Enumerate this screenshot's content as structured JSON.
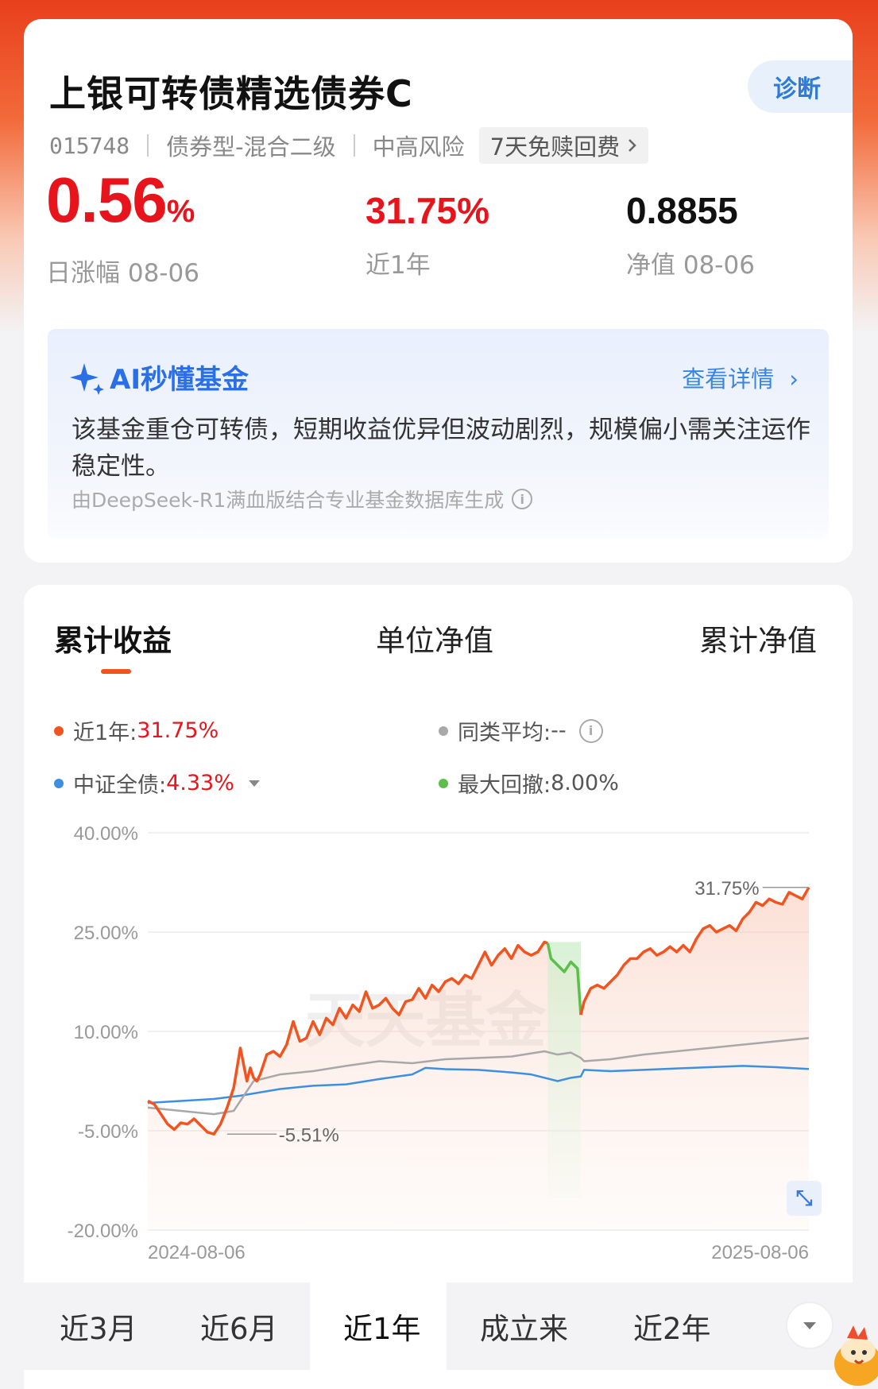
{
  "header": {
    "fund_name": "上银可转债精选债券C",
    "diagnose_label": "诊断",
    "code": "015748",
    "category": "债券型-混合二级",
    "risk": "中高风险",
    "redeem_tag": "7天免赎回费"
  },
  "stats": {
    "daily_change_value": "0.56",
    "daily_change_unit": "%",
    "daily_change_label": "日涨幅 08-06",
    "one_year_value": "31.75%",
    "one_year_label": "近1年",
    "nav_value": "0.8855",
    "nav_label": "净值 08-06"
  },
  "ai": {
    "title": "AI秒懂基金",
    "more": "查看详情",
    "summary": "该基金重仓可转债，短期收益优异但波动剧烈，规模偏小需关注运作稳定性。",
    "footnote": "由DeepSeek-R1满血版结合专业基金数据库生成"
  },
  "chart_tabs": [
    "累计收益",
    "单位净值",
    "累计净值"
  ],
  "legend": {
    "fund_label": "近1年:",
    "fund_value": "31.75%",
    "peer_label": "同类平均:",
    "peer_value": "--",
    "index_label": "中证全债:",
    "index_value": "4.33%",
    "drawdown_label": "最大回撤:",
    "drawdown_value": "8.00%"
  },
  "colors": {
    "fund": "#f2541f",
    "peer": "#a8a8a8",
    "index": "#3d8fe0",
    "drawdown": "#5bbf4a",
    "brand_red": "#e8141c"
  },
  "periods": [
    "近3月",
    "近6月",
    "近1年",
    "成立来",
    "近2年"
  ],
  "active_period": "近1年",
  "watermark": "天天基金",
  "chart_data": {
    "type": "line",
    "ylim": [
      -20,
      40
    ],
    "y_ticks": [
      "40.00%",
      "25.00%",
      "10.00%",
      "-5.00%",
      "-20.00%"
    ],
    "y_tick_values": [
      40,
      25,
      10,
      -5,
      -20
    ],
    "x_start_label": "2024-08-06",
    "x_end_label": "2025-08-06",
    "annotations": [
      {
        "text": "31.75%",
        "x": 1.0,
        "y": 31.75
      },
      {
        "text": "-5.51%",
        "x": 0.12,
        "y": -5.51
      }
    ],
    "drawdown_range": [
      0.605,
      0.655
    ],
    "series": [
      {
        "name": "近1年",
        "x": [
          0,
          0.01,
          0.02,
          0.03,
          0.04,
          0.05,
          0.06,
          0.07,
          0.08,
          0.09,
          0.1,
          0.11,
          0.12,
          0.13,
          0.14,
          0.15,
          0.155,
          0.16,
          0.165,
          0.17,
          0.18,
          0.19,
          0.2,
          0.21,
          0.22,
          0.23,
          0.24,
          0.25,
          0.26,
          0.27,
          0.28,
          0.29,
          0.3,
          0.31,
          0.32,
          0.33,
          0.34,
          0.35,
          0.36,
          0.37,
          0.38,
          0.39,
          0.4,
          0.41,
          0.42,
          0.43,
          0.44,
          0.45,
          0.46,
          0.47,
          0.48,
          0.49,
          0.5,
          0.51,
          0.52,
          0.53,
          0.54,
          0.55,
          0.56,
          0.57,
          0.58,
          0.59,
          0.6,
          0.605,
          0.61,
          0.62,
          0.63,
          0.64,
          0.65,
          0.655,
          0.66,
          0.67,
          0.68,
          0.69,
          0.7,
          0.71,
          0.72,
          0.73,
          0.74,
          0.75,
          0.76,
          0.77,
          0.78,
          0.79,
          0.8,
          0.81,
          0.82,
          0.83,
          0.84,
          0.85,
          0.86,
          0.87,
          0.88,
          0.89,
          0.9,
          0.91,
          0.92,
          0.93,
          0.94,
          0.95,
          0.96,
          0.97,
          0.98,
          0.99,
          1.0
        ],
        "y": [
          -0.5,
          -1.0,
          -2.5,
          -4.0,
          -4.8,
          -3.8,
          -4.0,
          -3.2,
          -4.2,
          -5.2,
          -5.51,
          -4.0,
          -1.5,
          1.5,
          7.5,
          2.5,
          4.5,
          3.0,
          2.5,
          3.5,
          6.5,
          7.0,
          6.2,
          8.0,
          11.5,
          8.5,
          9.0,
          11.5,
          9.5,
          12.0,
          11.0,
          13.5,
          12.0,
          14.0,
          13.0,
          16.0,
          13.5,
          14.0,
          15.0,
          13.5,
          12.5,
          14.5,
          14.8,
          16.5,
          15.0,
          17.0,
          16.0,
          17.5,
          18.0,
          17.2,
          18.5,
          18.0,
          20.0,
          22.0,
          20.0,
          21.5,
          22.5,
          21.0,
          23.0,
          22.0,
          21.5,
          22.0,
          23.5,
          23.3,
          21.0,
          20.0,
          19.0,
          20.5,
          19.5,
          12.5,
          14.5,
          16.5,
          17.0,
          16.5,
          17.5,
          18.5,
          20.0,
          21.0,
          21.0,
          22.0,
          22.5,
          21.5,
          22.0,
          22.8,
          22.0,
          23.0,
          22.0,
          24.0,
          25.5,
          26.0,
          25.0,
          25.5,
          26.0,
          25.2,
          27.0,
          28.0,
          29.5,
          29.0,
          30.0,
          29.5,
          29.2,
          31.0,
          30.5,
          30.0,
          31.75
        ]
      },
      {
        "name": "同类平均",
        "x": [
          0,
          0.05,
          0.1,
          0.13,
          0.16,
          0.2,
          0.25,
          0.3,
          0.35,
          0.4,
          0.45,
          0.5,
          0.55,
          0.6,
          0.62,
          0.64,
          0.655,
          0.66,
          0.7,
          0.75,
          0.8,
          0.85,
          0.9,
          0.95,
          1.0
        ],
        "y": [
          -1.5,
          -2.0,
          -2.5,
          -2.0,
          2.5,
          3.5,
          4.0,
          4.8,
          5.5,
          5.2,
          5.8,
          6.0,
          6.2,
          7.0,
          6.5,
          6.8,
          6.0,
          5.5,
          5.8,
          6.5,
          7.0,
          7.5,
          8.0,
          8.5,
          9.0
        ]
      },
      {
        "name": "中证全债",
        "x": [
          0,
          0.05,
          0.1,
          0.14,
          0.2,
          0.25,
          0.3,
          0.35,
          0.4,
          0.42,
          0.45,
          0.5,
          0.55,
          0.58,
          0.6,
          0.62,
          0.64,
          0.655,
          0.66,
          0.7,
          0.75,
          0.8,
          0.85,
          0.9,
          0.95,
          1.0
        ],
        "y": [
          -0.8,
          -0.5,
          -0.2,
          0.3,
          1.3,
          1.8,
          2.0,
          2.8,
          3.5,
          4.5,
          4.3,
          4.2,
          3.8,
          3.5,
          3.0,
          2.5,
          3.0,
          3.2,
          4.2,
          4.0,
          4.2,
          4.4,
          4.6,
          4.8,
          4.6,
          4.33
        ]
      }
    ]
  }
}
